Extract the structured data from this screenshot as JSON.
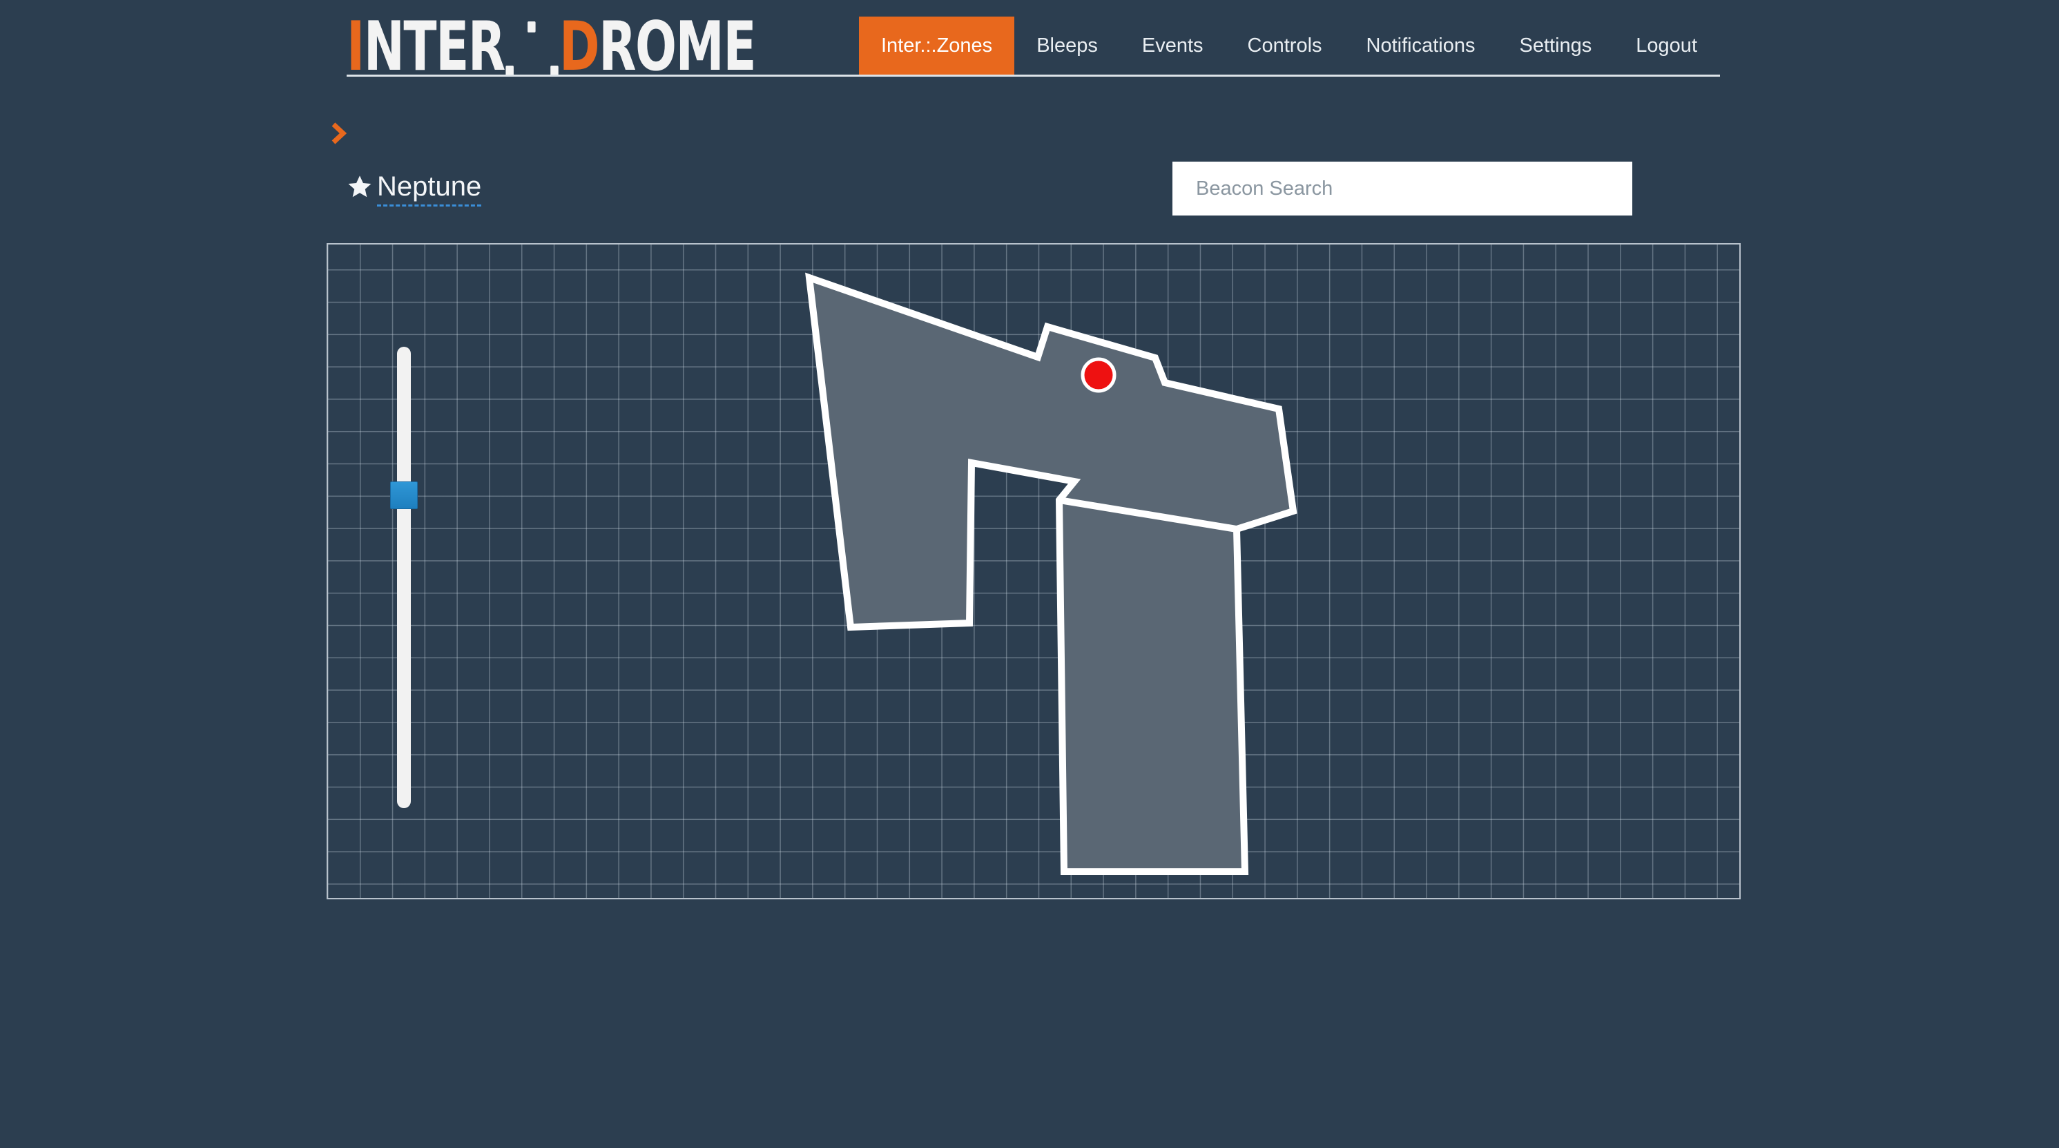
{
  "logo": {
    "text_start_accent": "I",
    "text_start_rest": "NTER",
    "text_end_accent": "D",
    "text_end_rest": "ROME",
    "accent_color": "#e8681d"
  },
  "nav": {
    "items": [
      {
        "label": "Inter.:.Zones",
        "active": true
      },
      {
        "label": "Bleeps",
        "active": false
      },
      {
        "label": "Events",
        "active": false
      },
      {
        "label": "Controls",
        "active": false
      },
      {
        "label": "Notifications",
        "active": false
      },
      {
        "label": "Settings",
        "active": false
      },
      {
        "label": "Logout",
        "active": false
      }
    ]
  },
  "breadcrumb": {
    "icon": "chevron-right-icon"
  },
  "site": {
    "title": "Neptune",
    "favorite_icon": "star-icon"
  },
  "search": {
    "placeholder": "Beacon Search",
    "value": ""
  },
  "map": {
    "zoom_level_fraction": 0.31,
    "zone_fill": "#5a6774",
    "zone_stroke": "#ffffff",
    "marker_color": "#ee1111"
  },
  "colors": {
    "background": "#2c3e50",
    "accent": "#e8681d",
    "slider_handle": "#2589c9"
  }
}
